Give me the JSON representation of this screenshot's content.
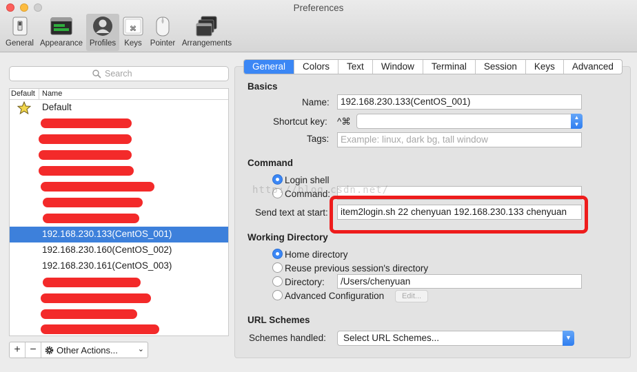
{
  "window": {
    "title": "Preferences"
  },
  "toolbar": {
    "items": [
      {
        "label": "General"
      },
      {
        "label": "Appearance"
      },
      {
        "label": "Profiles"
      },
      {
        "label": "Keys"
      },
      {
        "label": "Pointer"
      },
      {
        "label": "Arrangements"
      }
    ],
    "keys_icon_glyph": "⌘"
  },
  "search": {
    "placeholder": "Search"
  },
  "profile_list": {
    "col_default": "Default",
    "col_name": "Name",
    "rows": [
      {
        "name": "Default",
        "default": true
      },
      {
        "name": ""
      },
      {
        "name": ""
      },
      {
        "name": ""
      },
      {
        "name": ""
      },
      {
        "name": ""
      },
      {
        "name": ""
      },
      {
        "name": ""
      },
      {
        "name": "192.168.230.133(CentOS_001)",
        "selected": true
      },
      {
        "name": "192.168.230.160(CentOS_002)"
      },
      {
        "name": "192.168.230.161(CentOS_003)"
      }
    ]
  },
  "list_buttons": {
    "add": "+",
    "remove": "−",
    "actions": "Other Actions..."
  },
  "tabs": [
    "General",
    "Colors",
    "Text",
    "Window",
    "Terminal",
    "Session",
    "Keys",
    "Advanced"
  ],
  "basics": {
    "title": "Basics",
    "name_label": "Name:",
    "name_value": "192.168.230.133(CentOS_001)",
    "shortcut_label": "Shortcut key:",
    "shortcut_prefix": "^⌘",
    "tags_label": "Tags:",
    "tags_placeholder": "Example: linux, dark bg, tall window"
  },
  "command": {
    "title": "Command",
    "login_shell": "Login shell",
    "command_label": "Command:",
    "send_text_label": "Send text at start:",
    "send_text_value": "item2login.sh 22 chenyuan 192.168.230.133 chenyuan"
  },
  "working_directory": {
    "title": "Working Directory",
    "home": "Home directory",
    "reuse": "Reuse previous session's directory",
    "directory_label": "Directory:",
    "directory_value": "/Users/chenyuan",
    "advanced": "Advanced Configuration",
    "edit_button": "Edit..."
  },
  "url_schemes": {
    "title": "URL Schemes",
    "handled_label": "Schemes handled:",
    "select_value": "Select URL Schemes..."
  },
  "watermark": "http://blog.csdn.net/",
  "colors": {
    "accent": "#3b87f5",
    "selection": "#3d80db",
    "annotation": "#ee1c1c"
  }
}
